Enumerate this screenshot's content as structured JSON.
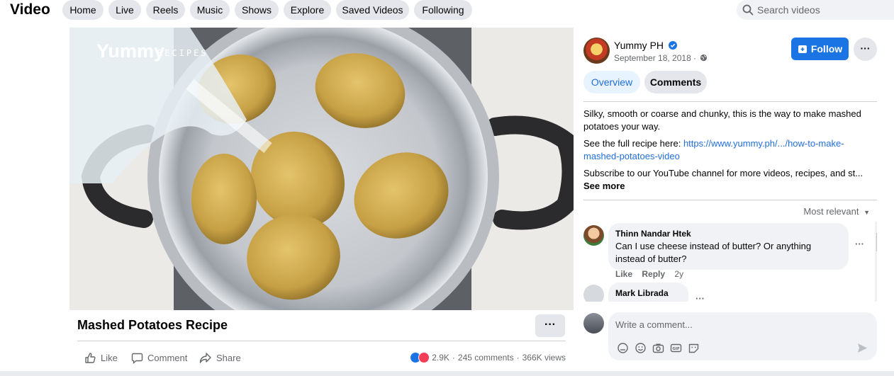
{
  "topbar": {
    "title": "Video",
    "tabs": [
      {
        "label": "Home"
      },
      {
        "label": "Live"
      },
      {
        "label": "Reels"
      },
      {
        "label": "Music"
      },
      {
        "label": "Shows"
      },
      {
        "label": "Explore"
      },
      {
        "label": "Saved Videos"
      },
      {
        "label": "Following"
      }
    ],
    "search": {
      "placeholder": "Search videos",
      "icon": "search-icon"
    }
  },
  "video": {
    "watermark_main": "Yummy",
    "watermark_sub": "RECIPES",
    "title": "Mashed Potatoes Recipe",
    "more_label": "···",
    "actions": {
      "like": "Like",
      "comment": "Comment",
      "share": "Share"
    },
    "stats": {
      "reactions": "2.9K",
      "separator": "·",
      "comments": "245 comments",
      "views": "366K views"
    }
  },
  "sidebar": {
    "page_name": "Yummy PH",
    "verified_icon": "verified-badge-icon",
    "date": "September 18, 2018 ·",
    "privacy_icon": "globe-icon",
    "follow_label": "Follow",
    "more_label": "···",
    "tabs": [
      {
        "label": "Overview"
      },
      {
        "label": "Comments"
      }
    ],
    "description": {
      "line1": "Silky, smooth or coarse and chunky, this is the way to make mashed potatoes your way.",
      "link_prefix": "See the full recipe here:",
      "link_text": "https://www.yummy.ph/.../how-to-make-mashed-potatoes-video",
      "line3": "Subscribe to our YouTube channel for more videos, recipes, and st...",
      "see_more": "See more"
    },
    "sort_label": "Most relevant",
    "comments": [
      {
        "name": "Thinn Nandar Htek",
        "text": "Can I use cheese instead of butter? Or anything instead of butter?",
        "like": "Like",
        "reply": "Reply",
        "time": "2y"
      },
      {
        "name": "Mark Librada",
        "text": "...",
        "like": "",
        "reply": "",
        "time": ""
      }
    ],
    "composer": {
      "placeholder": "Write a comment...",
      "icons": [
        "avatar-sticker-icon",
        "emoji-icon",
        "camera-icon",
        "gif-icon",
        "sticker-icon"
      ],
      "send_icon": "send-icon"
    }
  },
  "colors": {
    "accent": "#1b74e4",
    "link": "#216fdb",
    "pill_bg": "#e4e6eb",
    "muted": "#65676b"
  }
}
